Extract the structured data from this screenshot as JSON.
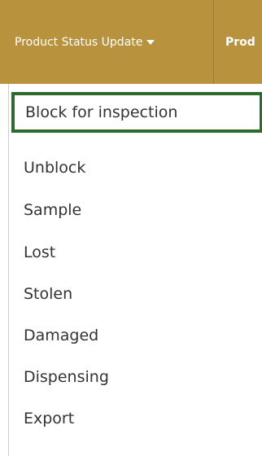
{
  "navbar": {
    "items": [
      {
        "label": "Product Status Update",
        "has_dropdown": true
      },
      {
        "label": "Prod"
      }
    ]
  },
  "dropdown": {
    "items": [
      {
        "label": "Block for inspection",
        "selected": true
      },
      {
        "label": "Unblock"
      },
      {
        "label": "Sample"
      },
      {
        "label": "Lost"
      },
      {
        "label": "Stolen"
      },
      {
        "label": "Damaged"
      },
      {
        "label": "Dispensing"
      },
      {
        "label": "Export"
      }
    ]
  },
  "colors": {
    "navbar_bg": "#b8923c",
    "selected_border": "#2d6a2d",
    "menu_text": "#333333"
  }
}
